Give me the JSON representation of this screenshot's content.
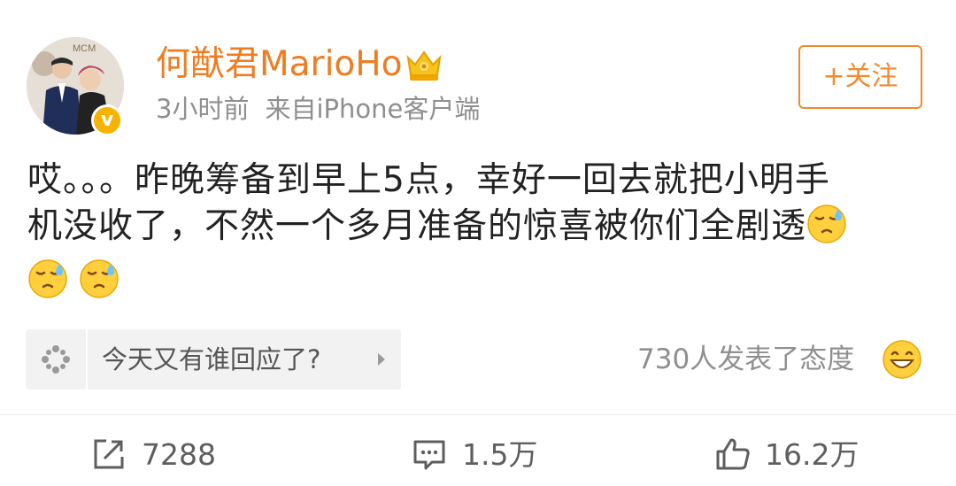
{
  "post": {
    "username": "何猷君MarioHo",
    "time": "3小时前",
    "source": "来自iPhone客户端",
    "follow_label": "+关注",
    "verified_mark": "v",
    "content_line1": "哎。。。昨晚筹备到早上5点，幸好一回去就把小明手",
    "content_line2": "机没收了，不然一个多月准备的惊喜被你们全剧透",
    "avatar_text": "MCM"
  },
  "reply_prompt": {
    "text": "今天又有谁回应了?"
  },
  "reactions": {
    "text": "730人发表了态度"
  },
  "actions": {
    "repost_count": "7288",
    "comment_count": "1.5万",
    "like_count": "16.2万"
  },
  "icons": {
    "crown": "crown-vip-icon",
    "verified": "verified-badge-icon",
    "emoji": "sweat-emoji-icon",
    "reply": "sparkle-icon",
    "react": "grin-emoji-icon",
    "repost": "repost-icon",
    "comment": "comment-icon",
    "like": "thumbs-up-icon"
  },
  "colors": {
    "brand_orange": "#ee7d21",
    "follow_border": "#f08a2c",
    "text_main": "#222222",
    "text_meta": "#8f8f8f"
  }
}
